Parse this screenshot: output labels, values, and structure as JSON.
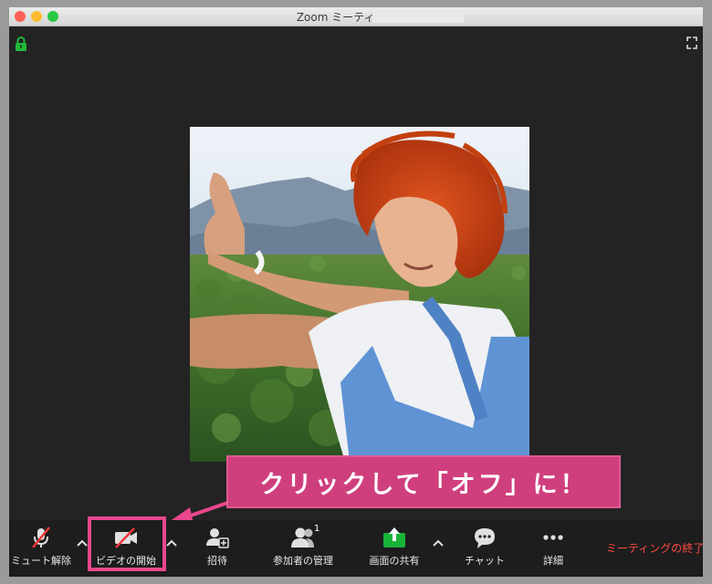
{
  "window": {
    "title": "Zoom ミーティング ID:"
  },
  "colors": {
    "accent": "#cf3f7d",
    "share_green": "#19b33a",
    "end_red": "#ff4a40",
    "highlight": "#e8478e"
  },
  "callout": {
    "text": "クリックして「オフ」に！"
  },
  "toolbar": {
    "mute_label": "ミュート解除",
    "video_label": "ビデオの開始",
    "invite_label": "招待",
    "participants_label": "参加者の管理",
    "participants_count": "1",
    "share_label": "画面の共有",
    "chat_label": "チャット",
    "more_label": "詳細",
    "end_label": "ミーティングの終了"
  },
  "icons": [
    "lock-icon",
    "fullscreen-icon",
    "microphone-muted-icon",
    "video-off-icon",
    "invite-icon",
    "participants-icon",
    "share-screen-icon",
    "chat-icon",
    "more-icon",
    "chevron-up-icon"
  ]
}
